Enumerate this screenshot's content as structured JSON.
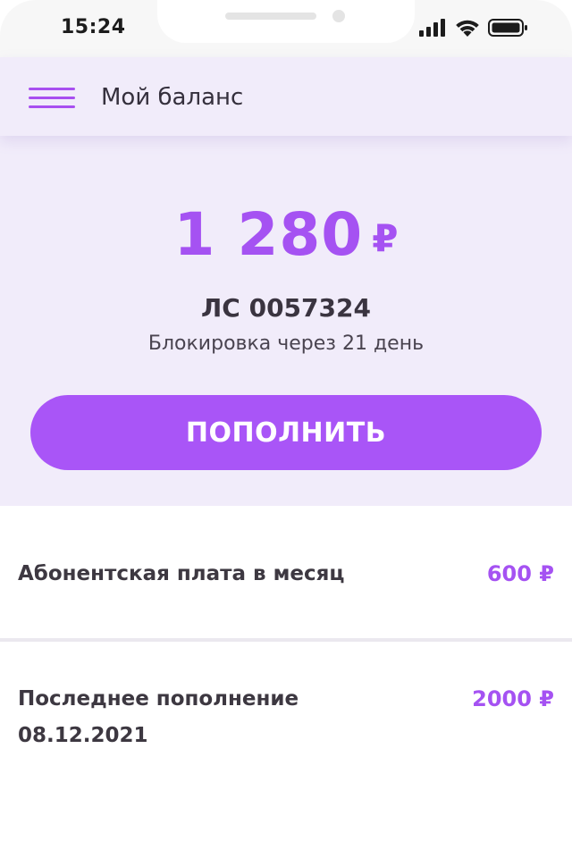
{
  "status_bar": {
    "time": "15:24",
    "icons": [
      "signal-icon",
      "wifi-icon",
      "battery-icon"
    ]
  },
  "header": {
    "menu_icon": "hamburger-menu-icon",
    "title": "Мой баланс"
  },
  "balance": {
    "amount": "1 280",
    "currency": "₽",
    "account": "ЛС 0057324",
    "block_notice": "Блокировка через 21 день",
    "topup_label": "ПОПОЛНИТЬ"
  },
  "info": {
    "monthly_fee": {
      "label": "Абонентская плата в месяц",
      "value": "600 ₽"
    },
    "last_topup": {
      "label": "Последнее пополнение",
      "date": "08.12.2021",
      "value": "2000 ₽"
    }
  },
  "colors": {
    "accent": "#a955f7",
    "panel_background": "#f1ecfa",
    "text_dark": "#3a3440",
    "divider": "#ebe8ef"
  }
}
